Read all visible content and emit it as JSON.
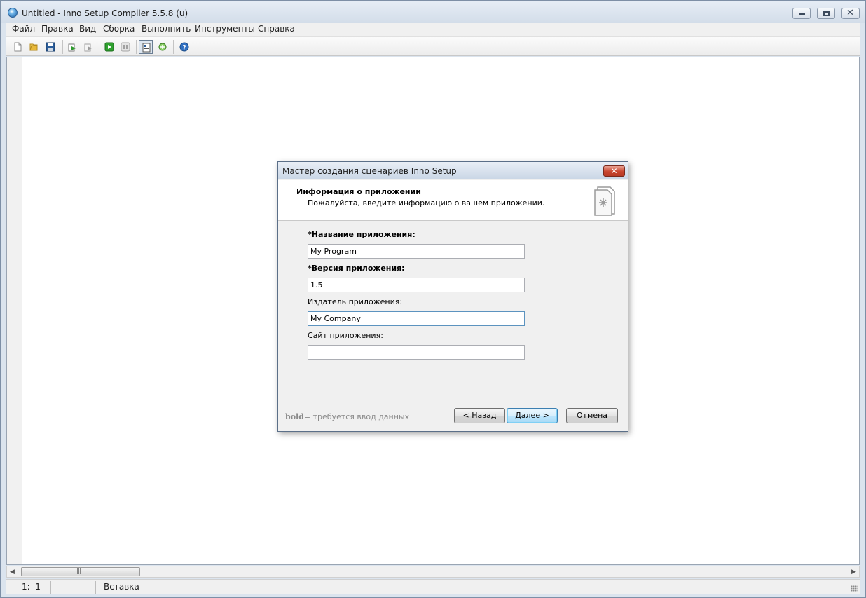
{
  "window": {
    "title": "Untitled - Inno Setup Compiler 5.5.8 (u)"
  },
  "menu": {
    "items": [
      "Файл",
      "Правка",
      "Вид",
      "Сборка",
      "Выполнить",
      "Инструменты",
      "Справка"
    ]
  },
  "toolbar": {
    "buttons": [
      "new-file-icon",
      "open-folder-icon",
      "save-icon",
      "compile-icon",
      "stop-compile-icon",
      "run-icon",
      "pause-icon",
      "wizard-icon",
      "target-icon",
      "help-icon"
    ]
  },
  "status": {
    "position": "1:  1",
    "mode": "Вставка"
  },
  "dialog": {
    "title": "Мастер создания сценариев Inno Setup",
    "close_label": "✕",
    "header_title": "Информация о приложении",
    "header_subtitle": "Пожалуйста, введите информацию о вашем приложении.",
    "fields": [
      {
        "label": "*Название приложения:",
        "value": "My Program",
        "required": true
      },
      {
        "label": "*Версия приложения:",
        "value": "1.5",
        "required": true
      },
      {
        "label": "Издатель приложения:",
        "value": "My Company",
        "required": false
      },
      {
        "label": "Сайт приложения:",
        "value": "",
        "required": false
      }
    ],
    "legend_bold": "bold",
    "legend_text": "= требуется ввод данных",
    "back_label": "< Назад",
    "next_label": "Далее >",
    "cancel_label": "Отмена"
  },
  "colors": {
    "accent": "#3c7fb1",
    "close_red": "#c9452e"
  }
}
